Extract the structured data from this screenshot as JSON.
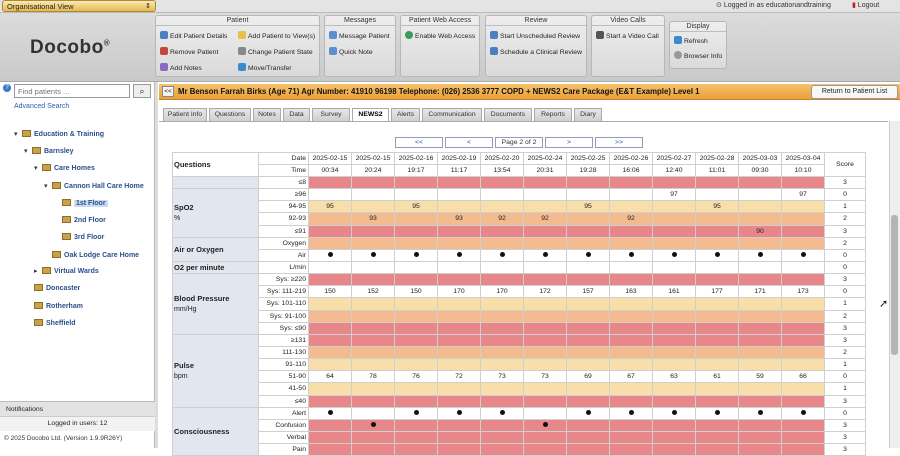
{
  "topbar": {
    "view": "Organisational View",
    "logged_as": "Logged in as educationandtraining",
    "logout": "Logout"
  },
  "logo": "Docobo",
  "toolbar": {
    "patient": {
      "title": "Patient",
      "edit": "Edit Patient Details",
      "add_view": "Add Patient to View(s)",
      "remove": "Remove Patient",
      "change_state": "Change Patient State",
      "add_notes": "Add Notes",
      "move": "Move/Transfer"
    },
    "messages": {
      "title": "Messages",
      "message": "Message Patient",
      "quick": "Quick Note"
    },
    "web": {
      "title": "Patient Web Access",
      "enable": "Enable Web Access"
    },
    "review": {
      "title": "Review",
      "start": "Start Unscheduled Review",
      "schedule": "Schedule a Clinical Review"
    },
    "video": {
      "title": "Video Calls",
      "start": "Start a Video Call"
    },
    "display": {
      "title": "Display",
      "refresh": "Refresh",
      "browser": "Browser Info"
    }
  },
  "sidebar": {
    "search_placeholder": "Find patients ...",
    "advanced": "Advanced Search",
    "tree": [
      "Education & Training",
      "Barnsley",
      "Care Homes",
      "Cannon Hall Care Home",
      "1st Floor",
      "2nd Floor",
      "3rd Floor",
      "Oak Lodge Care Home",
      "Virtual Wards",
      "Doncaster",
      "Rotherham",
      "Sheffield"
    ],
    "notifications": "Notifications",
    "logged_users": "Logged in users: 12",
    "copyright": "© 2025 Docobo Ltd. (Version 1.9.9R26Y)"
  },
  "patient_bar": {
    "collapse": "<<",
    "info": "Mr Benson Farrah Birks   (Age 71)   Agr Number: 41910 96198   Telephone: (026) 2536 3777   COPD + NEWS2 Care Package (E&T Example) Level 1",
    "return": "Return to Patient List"
  },
  "tabs": [
    "Patient Info",
    "Questions",
    "Notes",
    "Data",
    "Survey",
    "NEWS2",
    "Alerts",
    "Communication",
    "Documents",
    "Reports",
    "Diary"
  ],
  "active_tab": "NEWS2",
  "pager": {
    "first": "<<",
    "prev": "<",
    "label": "Page 2 of 2",
    "next": ">",
    "last": ">>"
  },
  "grid": {
    "questions_label": "Questions",
    "date_label": "Date",
    "time_label": "Time",
    "score_label": "Score",
    "dates": [
      "2025-02-15",
      "2025-02-15",
      "2025-02-16",
      "2025-02-19",
      "2025-02-20",
      "2025-02-24",
      "2025-02-25",
      "2025-02-26",
      "2025-02-27",
      "2025-02-28",
      "2025-03-03",
      "2025-03-04"
    ],
    "times": [
      "00:34",
      "20:24",
      "19:17",
      "11:17",
      "13:54",
      "20:31",
      "19:28",
      "16:06",
      "12:40",
      "11:01",
      "09:30",
      "10:10"
    ],
    "sections": [
      {
        "q": "",
        "sub": "",
        "rows": [
          {
            "label": "≤8",
            "score": "3",
            "band": 3,
            "vals": [
              "",
              "",
              "",
              "",
              "",
              "",
              "",
              "",
              "",
              "",
              "",
              ""
            ]
          }
        ]
      },
      {
        "q": "SpO2",
        "sub": "%",
        "rows": [
          {
            "label": "≥96",
            "score": "0",
            "band": 0,
            "vals": [
              "",
              "",
              "",
              "",
              "",
              "",
              "",
              "",
              "97",
              "",
              "",
              "97"
            ]
          },
          {
            "label": "94-95",
            "score": "1",
            "band": 1,
            "vals": [
              "95",
              "",
              "95",
              "",
              "",
              "",
              "95",
              "",
              "",
              "95",
              "",
              ""
            ]
          },
          {
            "label": "92-93",
            "score": "2",
            "band": 2,
            "vals": [
              "",
              "93",
              "",
              "93",
              "92",
              "92",
              "",
              "92",
              "",
              "",
              "",
              ""
            ]
          },
          {
            "label": "≤91",
            "score": "3",
            "band": 3,
            "vals": [
              "",
              "",
              "",
              "",
              "",
              "",
              "",
              "",
              "",
              "",
              "90",
              ""
            ]
          }
        ]
      },
      {
        "q": "Air or Oxygen",
        "sub": "",
        "rows": [
          {
            "label": "Oxygen",
            "score": "2",
            "band": 2,
            "vals": [
              "",
              "",
              "",
              "",
              "",
              "",
              "",
              "",
              "",
              "",
              "",
              ""
            ]
          },
          {
            "label": "Air",
            "score": "0",
            "band": 0,
            "vals": [
              "•",
              "•",
              "•",
              "•",
              "•",
              "•",
              "•",
              "•",
              "•",
              "•",
              "•",
              "•"
            ]
          }
        ]
      },
      {
        "q": "O2 per minute",
        "sub": "",
        "rows": [
          {
            "label": "L/min",
            "score": "0",
            "band": 0,
            "vals": [
              "",
              "",
              "",
              "",
              "",
              "",
              "",
              "",
              "",
              "",
              "",
              ""
            ]
          }
        ]
      },
      {
        "q": "Blood Pressure",
        "sub": "mm/Hg",
        "rows": [
          {
            "label": "Sys: ≥220",
            "score": "3",
            "band": 3,
            "vals": [
              "",
              "",
              "",
              "",
              "",
              "",
              "",
              "",
              "",
              "",
              "",
              ""
            ]
          },
          {
            "label": "Sys: 111-219",
            "score": "0",
            "band": 0,
            "vals": [
              "150",
              "152",
              "150",
              "170",
              "170",
              "172",
              "157",
              "163",
              "161",
              "177",
              "171",
              "173"
            ]
          },
          {
            "label": "Sys: 101-110",
            "score": "1",
            "band": 1,
            "vals": [
              "",
              "",
              "",
              "",
              "",
              "",
              "",
              "",
              "",
              "",
              "",
              ""
            ]
          },
          {
            "label": "Sys: 91-100",
            "score": "2",
            "band": 2,
            "vals": [
              "",
              "",
              "",
              "",
              "",
              "",
              "",
              "",
              "",
              "",
              "",
              ""
            ]
          },
          {
            "label": "Sys: ≤90",
            "score": "3",
            "band": 3,
            "vals": [
              "",
              "",
              "",
              "",
              "",
              "",
              "",
              "",
              "",
              "",
              "",
              ""
            ]
          }
        ]
      },
      {
        "q": "Pulse",
        "sub": "bpm",
        "rows": [
          {
            "label": "≥131",
            "score": "3",
            "band": 3,
            "vals": [
              "",
              "",
              "",
              "",
              "",
              "",
              "",
              "",
              "",
              "",
              "",
              ""
            ]
          },
          {
            "label": "111-130",
            "score": "2",
            "band": 2,
            "vals": [
              "",
              "",
              "",
              "",
              "",
              "",
              "",
              "",
              "",
              "",
              "",
              ""
            ]
          },
          {
            "label": "91-110",
            "score": "1",
            "band": 1,
            "vals": [
              "",
              "",
              "",
              "",
              "",
              "",
              "",
              "",
              "",
              "",
              "",
              ""
            ]
          },
          {
            "label": "51-90",
            "score": "0",
            "band": 0,
            "vals": [
              "64",
              "78",
              "76",
              "72",
              "73",
              "73",
              "69",
              "67",
              "63",
              "61",
              "59",
              "66"
            ]
          },
          {
            "label": "41-50",
            "score": "1",
            "band": 1,
            "vals": [
              "",
              "",
              "",
              "",
              "",
              "",
              "",
              "",
              "",
              "",
              "",
              ""
            ]
          },
          {
            "label": "≤40",
            "score": "3",
            "band": 3,
            "vals": [
              "",
              "",
              "",
              "",
              "",
              "",
              "",
              "",
              "",
              "",
              "",
              ""
            ]
          }
        ]
      },
      {
        "q": "Consciousness",
        "sub": "",
        "rows": [
          {
            "label": "Alert",
            "score": "0",
            "band": 0,
            "vals": [
              "•",
              "",
              "•",
              "•",
              "•",
              "",
              "•",
              "•",
              "•",
              "•",
              "•",
              "•"
            ]
          },
          {
            "label": "Confusion",
            "score": "3",
            "band": 3,
            "vals": [
              "",
              "•",
              "",
              "",
              "",
              "•",
              "",
              "",
              "",
              "",
              "",
              ""
            ]
          },
          {
            "label": "Verbal",
            "score": "3",
            "band": 3,
            "vals": [
              "",
              "",
              "",
              "",
              "",
              "",
              "",
              "",
              "",
              "",
              "",
              ""
            ]
          },
          {
            "label": "Pain",
            "score": "3",
            "band": 3,
            "vals": [
              "",
              "",
              "",
              "",
              "",
              "",
              "",
              "",
              "",
              "",
              "",
              ""
            ]
          }
        ]
      }
    ]
  }
}
